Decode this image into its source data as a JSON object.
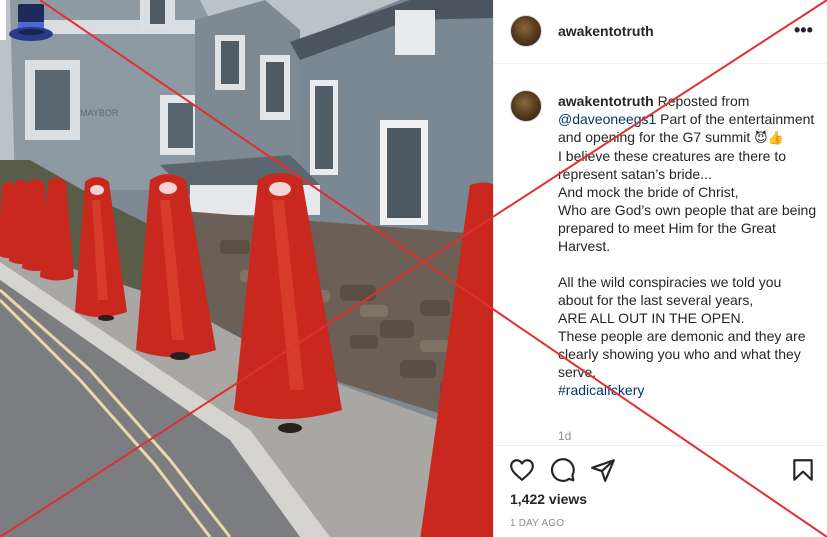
{
  "post": {
    "username": "awakentotruth",
    "more_label": "•••",
    "caption": {
      "reposted_from": " Reposted from",
      "mention": "@daveoneegs1",
      "intro": " Part of the entertainment and opening for the G7 summit ",
      "emojis": "😈👍",
      "lines": [
        "I believe these creatures are there to represent satan’s bride...",
        "And mock the bride of Christ,",
        "Who are God’s own people that are being prepared to meet Him for the Great Harvest.",
        "",
        "All the wild conspiracies we told you about for the last several years,",
        "ARE ALL OUT IN THE OPEN.",
        "These people are demonic and they are clearly showing you who and what they serve."
      ],
      "hashtag": "#radicalfckery"
    },
    "time_ago": "1d",
    "views": "1,422 views",
    "date": "1 DAY AGO"
  },
  "icons": {
    "more": "more-icon",
    "like": "heart-icon",
    "comment": "comment-icon",
    "share": "share-icon",
    "save": "bookmark-icon",
    "media_overlay": "top-hat-icon"
  },
  "colors": {
    "cross": "#e0302f",
    "link": "#00376b",
    "muted": "#8e8e8e",
    "robe": "#c8281e"
  }
}
